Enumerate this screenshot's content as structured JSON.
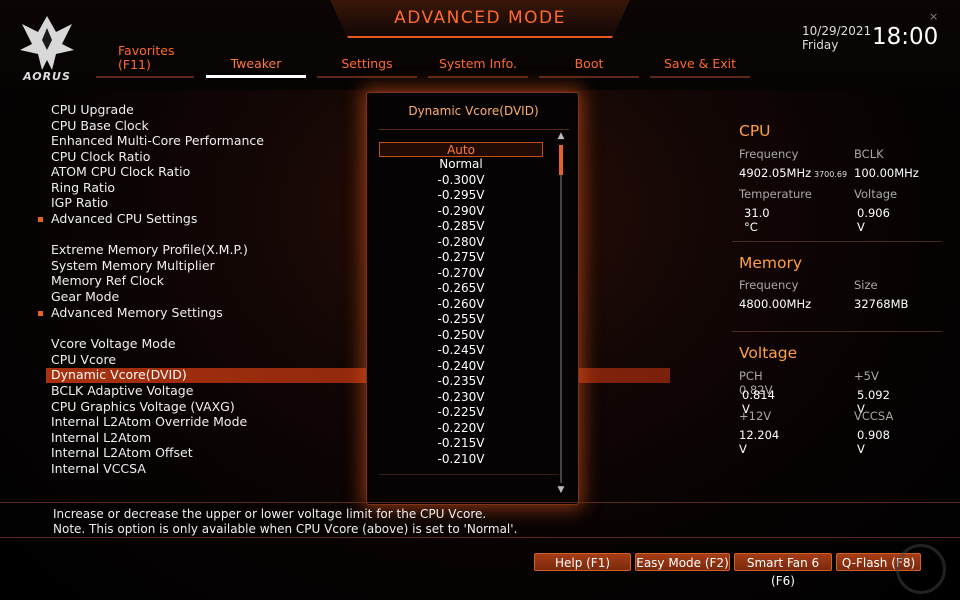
{
  "header": {
    "title": "ADVANCED MODE",
    "brand": "AORUS",
    "date": "10/29/2021",
    "day": "Friday",
    "time": "18:00",
    "close_glyph": "×"
  },
  "tabs": [
    {
      "label": "Favorites",
      "sub": "(F11)"
    },
    {
      "label": "Tweaker"
    },
    {
      "label": "Settings"
    },
    {
      "label": "System Info."
    },
    {
      "label": "Boot"
    },
    {
      "label": "Save & Exit"
    }
  ],
  "menu": [
    {
      "label": "CPU Upgrade"
    },
    {
      "label": "CPU Base Clock"
    },
    {
      "label": "Enhanced Multi-Core Performance"
    },
    {
      "label": "CPU Clock Ratio"
    },
    {
      "label": "ATOM CPU Clock Ratio"
    },
    {
      "label": "Ring Ratio"
    },
    {
      "label": "IGP Ratio"
    },
    {
      "label": "Advanced CPU Settings"
    },
    {
      "label": "Extreme Memory Profile(X.M.P.)"
    },
    {
      "label": "System Memory Multiplier"
    },
    {
      "label": "Memory Ref Clock"
    },
    {
      "label": "Gear Mode"
    },
    {
      "label": "Advanced Memory Settings"
    },
    {
      "label": "Vcore Voltage Mode"
    },
    {
      "label": "CPU Vcore"
    },
    {
      "label": "Dynamic Vcore(DVID)"
    },
    {
      "label": "BCLK Adaptive Voltage"
    },
    {
      "label": "CPU Graphics Voltage (VAXG)"
    },
    {
      "label": "Internal L2Atom Override Mode"
    },
    {
      "label": "Internal L2Atom"
    },
    {
      "label": "Internal L2Atom Offset"
    },
    {
      "label": "Internal VCCSA"
    }
  ],
  "popup": {
    "title": "Dynamic Vcore(DVID)",
    "options": [
      "Auto",
      "Normal",
      "-0.300V",
      "-0.295V",
      "-0.290V",
      "-0.285V",
      "-0.280V",
      "-0.275V",
      "-0.270V",
      "-0.265V",
      "-0.260V",
      "-0.255V",
      "-0.250V",
      "-0.245V",
      "-0.240V",
      "-0.235V",
      "-0.230V",
      "-0.225V",
      "-0.220V",
      "-0.215V",
      "-0.210V"
    ],
    "selected": "Auto",
    "scroll_up": "▲",
    "scroll_down": "▼"
  },
  "info": {
    "cpu": {
      "heading": "CPU",
      "frequency_label": "Frequency",
      "frequency": "4902.05MHz",
      "frequency_sub": "3700.69",
      "bclk_label": "BCLK",
      "bclk": "100.00MHz",
      "temperature_label": "Temperature",
      "temperature": "31.0 °C",
      "voltage_label": "Voltage",
      "voltage": "0.906 V"
    },
    "memory": {
      "heading": "Memory",
      "frequency_label": "Frequency",
      "frequency": "4800.00MHz",
      "size_label": "Size",
      "size": "32768MB"
    },
    "voltage": {
      "heading": "Voltage",
      "pch_label": "PCH 0.82V",
      "pch": "0.814 V",
      "p5v_label": "+5V",
      "p5v": "5.092 V",
      "p12v_label": "+12V",
      "p12v": "12.204 V",
      "vccsa_label": "VCCSA",
      "vccsa": "0.908 V"
    }
  },
  "help": {
    "line1": "Increase or decrease the upper or lower voltage limit for the CPU Vcore.",
    "line2": "Note. This option is only available when CPU Vcore (above) is set to 'Normal'."
  },
  "buttons": {
    "help": "Help (F1)",
    "easy": "Easy Mode (F2)",
    "fan": "Smart Fan 6 (F6)",
    "qflash": "Q-Flash (F8)"
  },
  "colors": {
    "accent": "#ff6a2a",
    "highlight": "#a9310f",
    "info_heading": "#ffa040"
  }
}
